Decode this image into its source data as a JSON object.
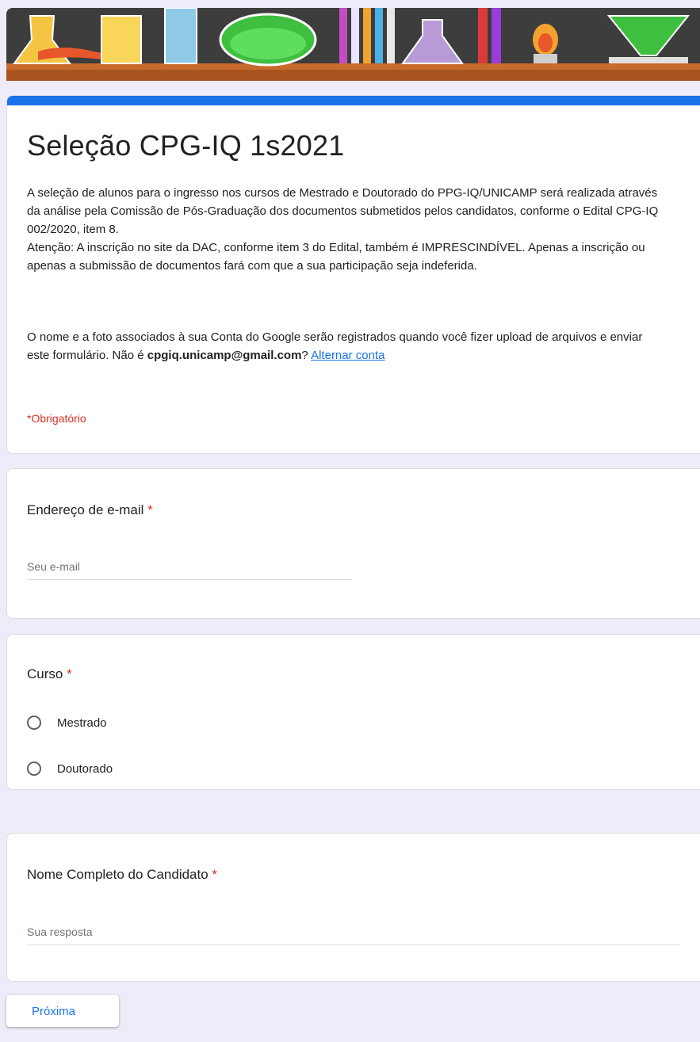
{
  "form": {
    "title": "Seleção CPG-IQ 1s2021",
    "description_parts": [
      "A seleção de alunos para o ingresso nos cursos de Mestrado e Doutorado do PPG-IQ/UNICAMP será realizada através da análise pela Comissão de Pós-Graduação dos documentos submetidos pelos candidatos, conforme o Edital CPG-IQ 002/2020, item 8.",
      "Atenção: A inscrição no site da DAC, conforme item 3 do Edital, também é IMPRESCINDÍVEL. Apenas a inscrição ou apenas a submissão de documentos fará com que a sua participação seja indeferida."
    ],
    "account_note_before": "O nome e a foto associados à sua Conta do Google serão registrados quando você fizer upload de arquivos e enviar este formulário. Não é ",
    "account_email": "cpgiq.unicamp@gmail.com",
    "account_note_after": "? ",
    "switch_account_link": "Alternar conta",
    "required_note": "*Obrigatório",
    "accent_color": "#1a73e8",
    "required_color": "#d93025"
  },
  "questions": {
    "email": {
      "label": "Endereço de e-mail",
      "required_mark": "*",
      "placeholder": "Seu e-mail"
    },
    "course": {
      "label": "Curso",
      "required_mark": "*",
      "options": [
        "Mestrado",
        "Doutorado"
      ]
    },
    "full_name": {
      "label": "Nome Completo do Candidato",
      "required_mark": "*",
      "placeholder": "Sua resposta"
    }
  },
  "actions": {
    "next_label": "Próxima"
  },
  "banner": {
    "icon": "chemistry-lab-glassware-illustration"
  }
}
